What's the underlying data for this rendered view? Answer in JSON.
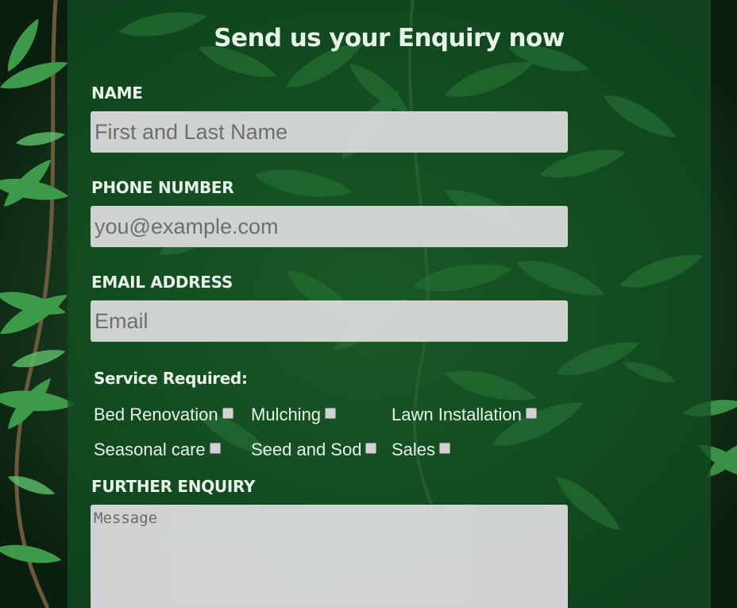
{
  "form": {
    "title": "Send us your Enquiry now",
    "name": {
      "label": "NAME",
      "placeholder": "First and Last Name"
    },
    "phone": {
      "label": "PHONE NUMBER",
      "placeholder": "you@example.com"
    },
    "email": {
      "label": "EMAIL ADDRESS",
      "placeholder": "Email"
    },
    "services": {
      "label": "Service Required:",
      "options": [
        "Bed Renovation",
        "Mulching",
        "Lawn Installation",
        "Seasonal care",
        "Seed and Sod",
        "Sales"
      ]
    },
    "message": {
      "label": "FURTHER ENQUIRY",
      "placeholder": "Message"
    }
  },
  "colors": {
    "panel": "#125222",
    "text": "#e8f2ea",
    "field": "#dcdcdc"
  }
}
